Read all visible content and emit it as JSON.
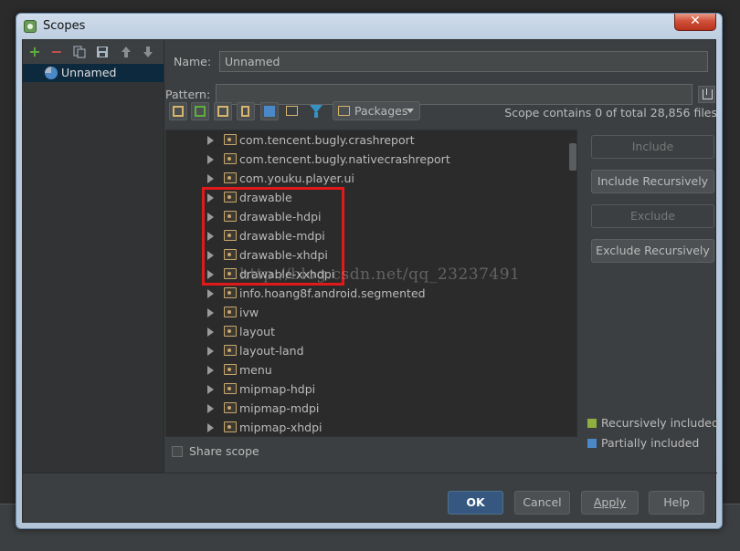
{
  "window": {
    "title": "Scopes",
    "close_label": "✕"
  },
  "toolbar": {
    "add": "+",
    "remove": "−"
  },
  "scopes": [
    {
      "label": "Unnamed"
    }
  ],
  "form": {
    "name_label": "Name:",
    "name_value": "Unnamed",
    "pattern_label": "Pattern:",
    "pattern_value": ""
  },
  "view": {
    "grouping": "Packages",
    "scope_info": "Scope contains 0 of total 28,856 files"
  },
  "tree": [
    "com.tencent.bugly.crashreport",
    "com.tencent.bugly.nativecrashreport",
    "com.youku.player.ui",
    "drawable",
    "drawable-hdpi",
    "drawable-mdpi",
    "drawable-xhdpi",
    "drawable-xxhdpi",
    "info.hoang8f.android.segmented",
    "ivw",
    "layout",
    "layout-land",
    "menu",
    "mipmap-hdpi",
    "mipmap-mdpi",
    "mipmap-xhdpi"
  ],
  "watermark": "http://blog.csdn.net/qq_23237491",
  "actions": {
    "include": "Include",
    "include_recursively": "Include Recursively",
    "exclude": "Exclude",
    "exclude_recursively": "Exclude Recursively"
  },
  "legend": [
    {
      "label": "Recursively included",
      "color": "#8fb040"
    },
    {
      "label": "Partially included",
      "color": "#4a88c7"
    }
  ],
  "share_scope": {
    "label": "Share scope",
    "checked": false
  },
  "footer": {
    "ok": "OK",
    "cancel": "Cancel",
    "apply": "Apply",
    "help": "Help"
  },
  "colors": {
    "selection": "#0d293e",
    "highlight_box": "#e0191b",
    "primary_button": "#365880"
  }
}
